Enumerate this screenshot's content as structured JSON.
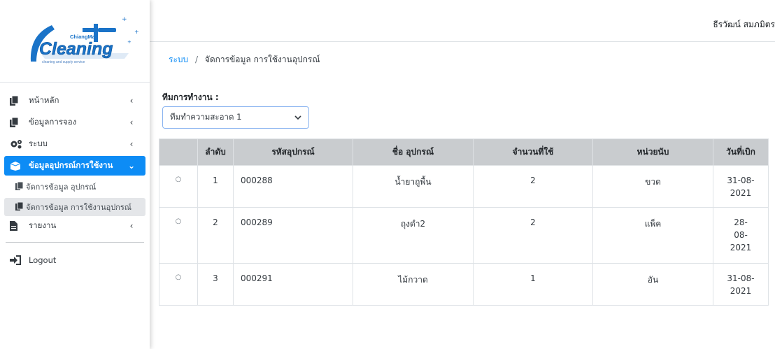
{
  "brand": {
    "logo_top": "ChiangMai",
    "logo_main": "Cleaning",
    "logo_tag": "cleaning and supply service"
  },
  "header": {
    "user_name": "ธีรวัฒน์ สมภมิตร"
  },
  "sidebar": {
    "items": [
      {
        "label": "หน้าหลัก",
        "icon": "copy-icon",
        "arrow": "‹"
      },
      {
        "label": "ข้อมูลการจอง",
        "icon": "copy-icon",
        "arrow": "‹"
      },
      {
        "label": "ระบบ",
        "icon": "gears-icon",
        "arrow": "‹"
      },
      {
        "label": "ข้อมูลอุปกรณ์การใช้งาน",
        "icon": "box-open-icon",
        "arrow": "⌄",
        "active": true
      },
      {
        "label": "รายงาน",
        "icon": "file-icon",
        "arrow": "‹"
      },
      {
        "label": "Logout",
        "icon": "sign-in-icon"
      }
    ],
    "sub_items": [
      {
        "label": "จัดการข้อมูล อุปกรณ์",
        "icon": "copy-icon"
      },
      {
        "label": "จัดการข้อมูล การใช้งานอุปกรณ์",
        "icon": "copy-icon",
        "selected": true
      }
    ]
  },
  "breadcrumb": {
    "root": "ระบบ",
    "separator": "/",
    "current": "จัดการข้อมูล การใช้งานอุปกรณ์"
  },
  "team": {
    "label": "ทีมการทำงาน :",
    "selected": "ทีมทำความสะอาด 1"
  },
  "table": {
    "headers": [
      "",
      "ลำดับ",
      "รหัสอุปกรณ์",
      "ชื่อ อุปกรณ์",
      "จำนวนที่ใช้",
      "หน่วยนับ",
      "วันที่เบิก"
    ],
    "rows": [
      {
        "radio": "○",
        "no": "1",
        "code": "000288",
        "name": "น้ำยาถูพื้น",
        "qty": "2",
        "unit": "ขวด",
        "date_lines": [
          "31-08-",
          "2021"
        ]
      },
      {
        "radio": "○",
        "no": "2",
        "code": "000289",
        "name": "ถุงดำ2",
        "qty": "2",
        "unit": "แพ็ค",
        "date_lines": [
          "28-",
          "08-",
          "2021"
        ]
      },
      {
        "radio": "○",
        "no": "3",
        "code": "000291",
        "name": "ไม้กวาด",
        "qty": "1",
        "unit": "อัน",
        "date_lines": [
          "31-08-",
          "2021"
        ]
      }
    ]
  },
  "colors": {
    "accent": "#0d8cf5",
    "header_bg": "#c9cccf",
    "logo_blue": "#1a73c8"
  }
}
